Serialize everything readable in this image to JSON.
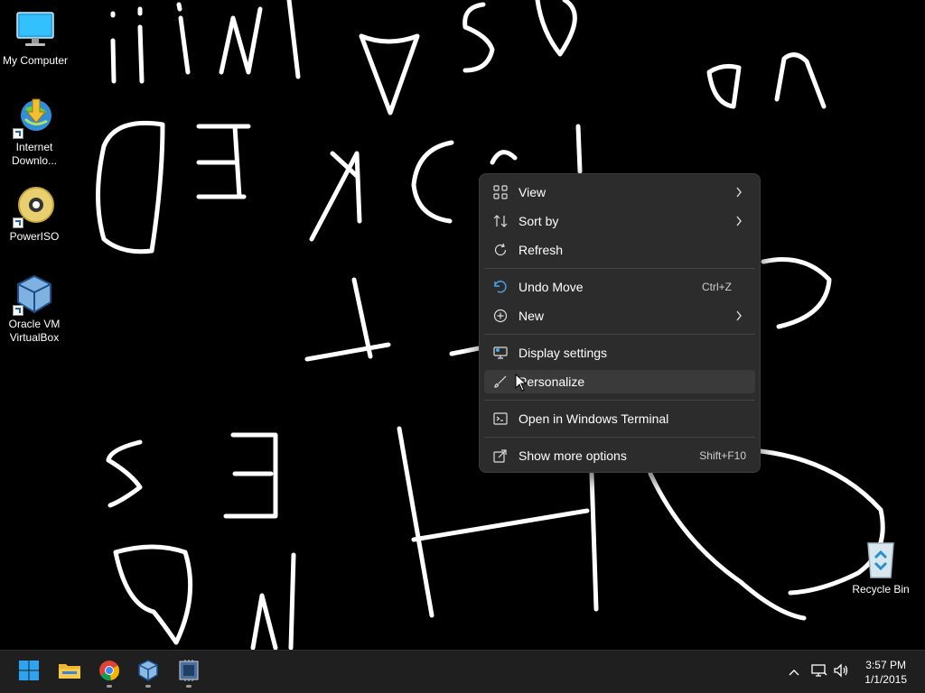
{
  "desktop": {
    "icons": [
      {
        "label": "My Computer",
        "icon": "monitor-icon"
      },
      {
        "label": "Internet\nDownlo...",
        "icon": "internet-download-manager-icon"
      },
      {
        "label": "PowerISO",
        "icon": "poweriso-disc-icon"
      },
      {
        "label": "Oracle VM\nVirtualBox",
        "icon": "virtualbox-cube-icon"
      },
      {
        "label": "Recycle Bin",
        "icon": "recycle-bin-icon"
      }
    ]
  },
  "context_menu": {
    "items": [
      {
        "label": "View",
        "icon": "grid-icon",
        "submenu": true
      },
      {
        "label": "Sort by",
        "icon": "sort-icon",
        "submenu": true
      },
      {
        "label": "Refresh",
        "icon": "refresh-icon"
      },
      {
        "label": "Undo Move",
        "icon": "undo-icon",
        "shortcut": "Ctrl+Z"
      },
      {
        "label": "New",
        "icon": "plus-circle-icon",
        "submenu": true
      },
      {
        "label": "Display settings",
        "icon": "display-settings-icon"
      },
      {
        "label": "Personalize",
        "icon": "brush-icon",
        "hovered": true
      },
      {
        "label": "Open in Windows Terminal",
        "icon": "terminal-icon"
      },
      {
        "label": "Show more options",
        "icon": "more-options-icon",
        "shortcut": "Shift+F10"
      }
    ]
  },
  "taskbar": {
    "apps": [
      {
        "name": "start-button",
        "icon": "windows-logo-icon"
      },
      {
        "name": "file-explorer",
        "icon": "folder-icon",
        "running": false
      },
      {
        "name": "chrome",
        "icon": "chrome-icon",
        "running": true
      },
      {
        "name": "virtualbox",
        "icon": "virtualbox-cube-icon",
        "running": true
      },
      {
        "name": "cpu-z",
        "icon": "cpuz-icon",
        "running": true
      }
    ],
    "tray_icons": [
      "chevron-up-icon",
      "network-icon",
      "volume-icon"
    ],
    "clock": {
      "time": "3:57 PM",
      "date": "1/1/2015"
    }
  },
  "colors": {
    "menu_bg": "#2c2c2c",
    "menu_hover": "#3a3a3a",
    "taskbar_bg": "#1f1f1f",
    "accent": "#0078d4"
  }
}
